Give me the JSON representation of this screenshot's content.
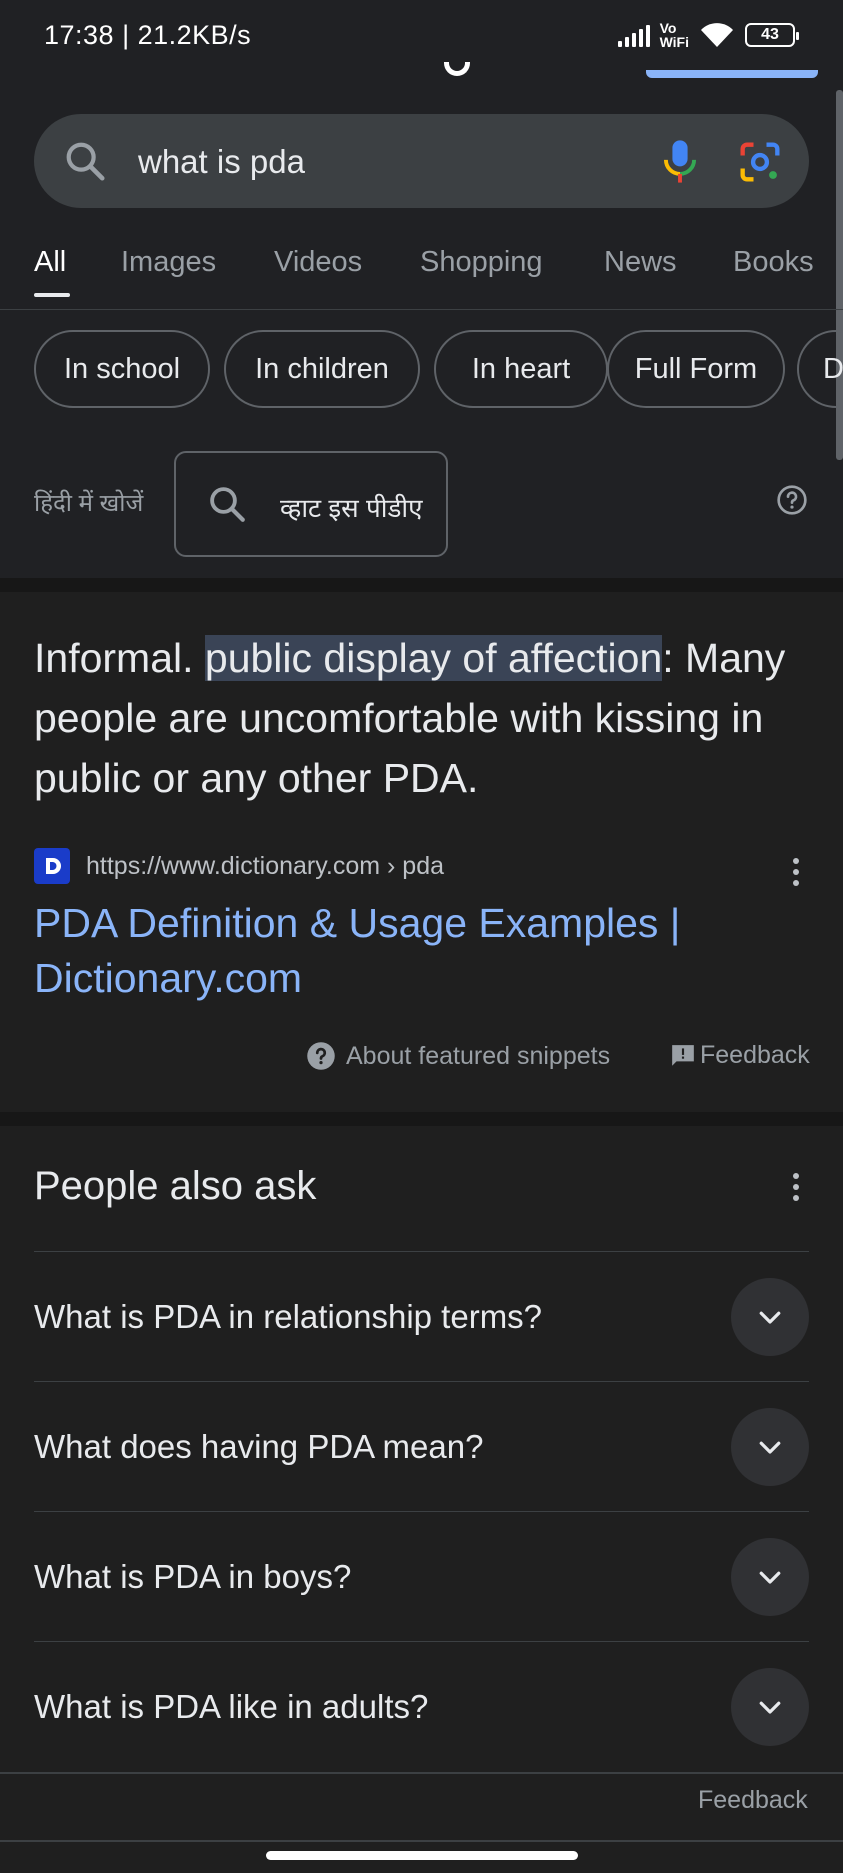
{
  "status_bar": {
    "time_speed": "17:38 | 21.2KB/s",
    "vowifi_top": "Vo",
    "vowifi_bottom": "WiFi",
    "battery": "43"
  },
  "search": {
    "query": "what is pda"
  },
  "tabs": [
    "All",
    "Images",
    "Videos",
    "Shopping",
    "News",
    "Books"
  ],
  "chips": [
    "In school",
    "In children",
    "In heart",
    "Full Form",
    "D"
  ],
  "hindi": {
    "label": "हिंदी में खोजें",
    "query": "व्हाट इस पीडीए"
  },
  "snippet": {
    "prefix": "Informal. ",
    "highlight": "public display of affection",
    "suffix": ": Many people are uncomfortable with kissing in public or any other PDA.",
    "source_url": "https://www.dictionary.com › pda",
    "title": "PDA Definition & Usage Examples | Dictionary.com",
    "about_label": "About featured snippets",
    "feedback_label": "Feedback"
  },
  "people_also_ask": {
    "title": "People also ask",
    "questions": [
      "What is PDA in relationship terms?",
      "What does having PDA mean?",
      "What is PDA in boys?",
      "What is PDA like in adults?"
    ]
  },
  "bottom": {
    "feedback_label": "Feedback"
  },
  "colors": {
    "background": "#1f1f1f",
    "link": "#8ab4f8",
    "highlight": "#3a4456"
  }
}
